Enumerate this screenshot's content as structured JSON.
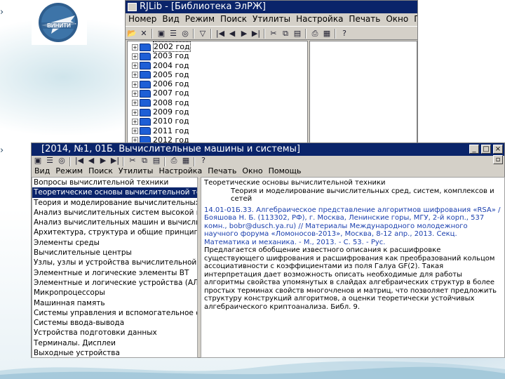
{
  "slide": {
    "logo_text": "ВИНИТИ",
    "colors": {
      "title_bar": "#0a246a",
      "selection": "#0a246a",
      "folder": "#1e5fd6",
      "link_text": "#1a3fae"
    }
  },
  "back_window": {
    "title": "RJLib - [Библиотека ЭлРЖ]",
    "menu": [
      "Номер",
      "Вид",
      "Режим",
      "Поиск",
      "Утилиты",
      "Настройка",
      "Печать",
      "Окно",
      "Помощь"
    ],
    "toolbar_icons": [
      "open-icon",
      "delete-icon",
      "save-icon",
      "list-icon",
      "binoculars-icon",
      "filter-icon",
      "first-icon",
      "prev-icon",
      "next-icon",
      "last-icon",
      "cut-icon",
      "copy-icon",
      "paste-icon",
      "print-icon",
      "preview-icon",
      "help-icon"
    ],
    "tree_items": [
      {
        "label": "2002 год",
        "selected": true
      },
      {
        "label": "2003 год"
      },
      {
        "label": "2004 год"
      },
      {
        "label": "2005 год"
      },
      {
        "label": "2006 год"
      },
      {
        "label": "2007 год"
      },
      {
        "label": "2008 год"
      },
      {
        "label": "2009 год"
      },
      {
        "label": "2010 год"
      },
      {
        "label": "2011 год"
      },
      {
        "label": "2012 год"
      }
    ]
  },
  "front_window": {
    "title": "[2014, №1, 01Б. Вычислительные машины и системы]",
    "menu": [
      "Вид",
      "Режим",
      "Поиск",
      "Утилиты",
      "Настройка",
      "Печать",
      "Окно",
      "Помощь"
    ],
    "toolbar_icons": [
      "save-icon",
      "list-icon",
      "binoculars-icon",
      "first-icon",
      "prev-icon",
      "next-icon",
      "last-icon",
      "cut-icon",
      "copy-icon",
      "paste-icon",
      "print-icon",
      "preview-icon",
      "help-icon"
    ],
    "list_items": [
      {
        "label": "Вопросы вычислительной техники"
      },
      {
        "label": "Теоретические основы вычислительной техники",
        "selected": true
      },
      {
        "label": "Теория и моделирование вычислительных сред, систем, сист..."
      },
      {
        "label": "Анализ вычислительных систем высокой производит..."
      },
      {
        "label": "Анализ вычислительных машин и вычислительные..."
      },
      {
        "label": "Архитектура, структура и общие принципы функциони..."
      },
      {
        "label": "Элементы среды"
      },
      {
        "label": "Вычислительные центры"
      },
      {
        "label": "Узлы, узлы и устройства вычислительной техники"
      },
      {
        "label": "Элементные и логические элементы ВТ"
      },
      {
        "label": "Элементные и логические устройства (АЛУ)"
      },
      {
        "label": "Микропроцессоры"
      },
      {
        "label": "Машинная память"
      },
      {
        "label": "Системы управления и вспомогательное оборудова..."
      },
      {
        "label": "Системы ввода-вывода"
      },
      {
        "label": "Устройства подготовки данных"
      },
      {
        "label": "Терминалы. Дисплеи"
      },
      {
        "label": "Выходные устройства"
      }
    ],
    "breadcrumb_line1": "Теоретические основы вычислительной техники",
    "breadcrumb_line2": "Теория и моделирование вычислительных сред, систем, комплексов и сетей",
    "abstract_ref": "14.01-01Б.33. Алгебраическое представление алгоритмов шифрования «RSA» / Бояшова Н. Б. (113302, РФ), г. Москва, Ленинские горы, МГУ, 2-й корп., 537 комн., bobr@dusch.ya.ru) // Материалы Международного молодежного научного форума «Ломоносов-2013», Москва, 8-12 апр., 2013. Секц. Математика и механика. - М., 2013. - С. 53. - Рус.",
    "abstract_body": "Предлагается обобщение известного описания к расшифровке существующего шифрования и расшифрования как преобразований кольцом ассоциативности с коэффициентами из поля Галуа GF(2). Такая интерпретация дает возможность описать необходимые для работы алгоритмы свойства упомянутых в слайдах алгебраических структур в более простых терминах свойств многочленов и матриц, что позволяет предложить структуру конструкций алгоритмов, а оценки теоретически устойчивых алгебраического криптоанализа. Библ. 9."
  }
}
